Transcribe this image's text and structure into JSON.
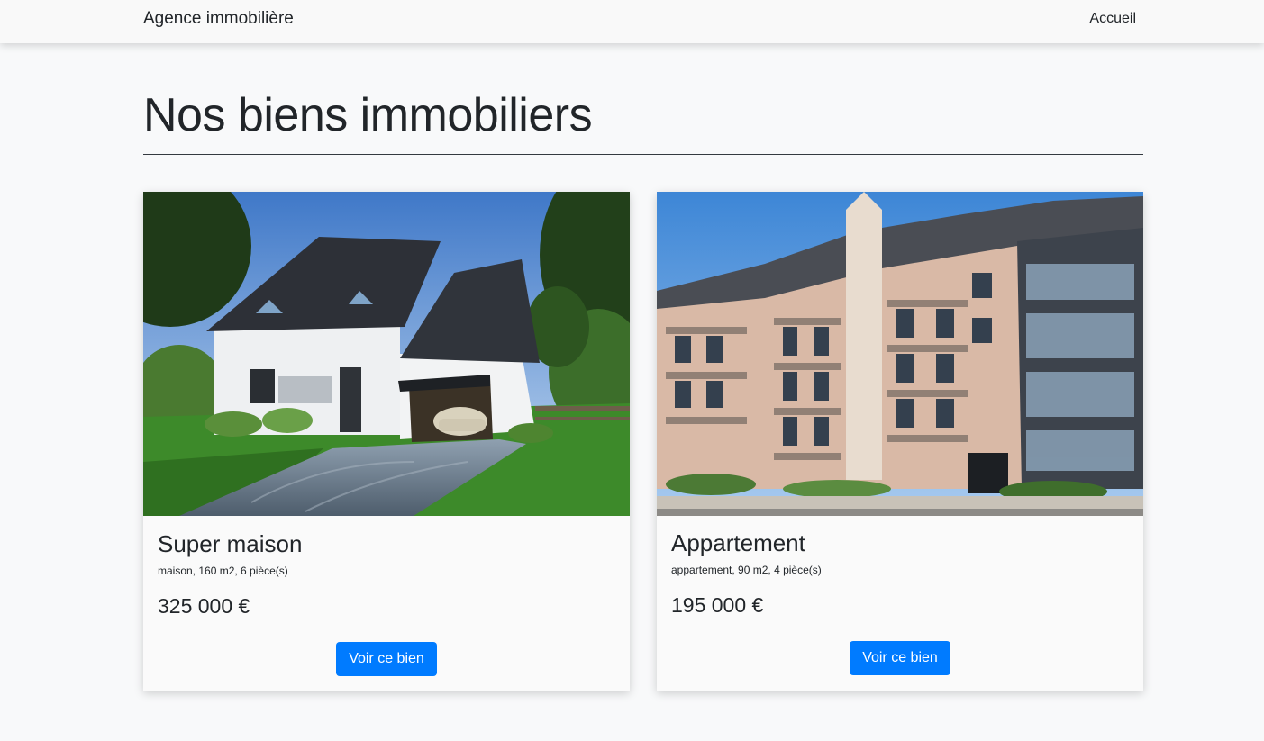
{
  "navbar": {
    "brand": "Agence immobilière",
    "links": [
      "Accueil"
    ]
  },
  "main": {
    "title": "Nos biens immobiliers"
  },
  "properties": [
    {
      "title": "Super maison",
      "details": "maison, 160 m2, 6 pièce(s)",
      "price": "325 000 €",
      "button_label": "Voir ce bien",
      "image": "house-photo"
    },
    {
      "title": "Appartement",
      "details": "appartement, 90 m2, 4 pièce(s)",
      "price": "195 000 €",
      "button_label": "Voir ce bien",
      "image": "apartment-building-photo"
    }
  ],
  "colors": {
    "primary_button": "#007bff",
    "background": "#f8f9fa",
    "text": "#212529"
  }
}
